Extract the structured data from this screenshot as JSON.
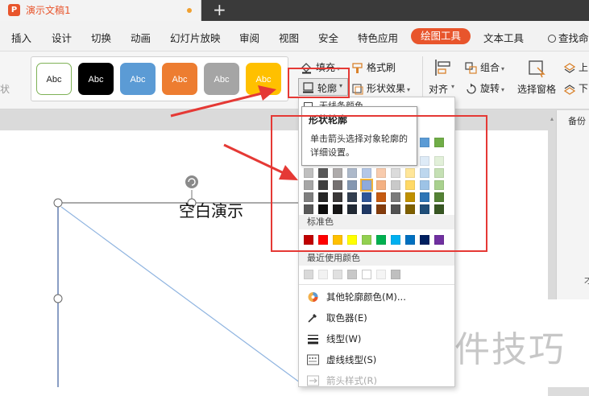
{
  "title_bar": {
    "doc_name": "演示文稿1",
    "new_tab": "+",
    "logo_glyph": "P"
  },
  "menu": {
    "items": [
      "插入",
      "设计",
      "切换",
      "动画",
      "幻灯片放映",
      "审阅",
      "视图",
      "安全",
      "特色应用"
    ],
    "active": "绘图工具",
    "after_active": "文本工具",
    "search": "查找命"
  },
  "ribbon": {
    "left_partial": "状",
    "styles": [
      {
        "label": "Abc",
        "fill": "#ffffff",
        "border": "#7fb257",
        "text": "#222222"
      },
      {
        "label": "Abc",
        "fill": "#000000",
        "border": "#000000",
        "text": "#ffffff"
      },
      {
        "label": "Abc",
        "fill": "#5b9bd5",
        "border": "#5b9bd5",
        "text": "#ffffff"
      },
      {
        "label": "Abc",
        "fill": "#ed7d31",
        "border": "#ed7d31",
        "text": "#ffffff"
      },
      {
        "label": "Abc",
        "fill": "#a5a5a5",
        "border": "#a5a5a5",
        "text": "#ffffff"
      },
      {
        "label": "Abc",
        "fill": "#ffc000",
        "border": "#ffc000",
        "text": "#ffffff"
      }
    ],
    "fill": "填充",
    "format_painter": "格式刷",
    "outline": "轮廓",
    "shape_effects": "形状效果",
    "align": "对齐",
    "group": "组合",
    "rotate": "旋转",
    "selection_pane": "选择窗格",
    "up": "上",
    "down": "下"
  },
  "dropdown": {
    "partial_top": "无线条颜色",
    "tooltip_title": "形状轮廓",
    "tooltip_desc": "单击箭头选择对象轮廓的详细设置。",
    "standard_label": "标准色",
    "recent_label": "最近使用颜色",
    "theme_colors": [
      [
        "#ffffff",
        "#000000",
        "#e7e6e6",
        "#44546a",
        "#4472c4",
        "#ed7d31",
        "#a5a5a5",
        "#ffc000",
        "#5b9bd5",
        "#70ad47"
      ],
      [
        "#d9d9d9",
        "#7f7f7f",
        "#d0cece",
        "#d6dce4",
        "#d9e2f3",
        "#fbe5d6",
        "#ededed",
        "#fff2cc",
        "#deebf7",
        "#e2f0d9"
      ],
      [
        "#bfbfbf",
        "#595959",
        "#aeabab",
        "#adb9ca",
        "#b4c7e7",
        "#f8cbad",
        "#dbdbdb",
        "#ffe699",
        "#bdd7ee",
        "#c5e0b4"
      ],
      [
        "#a6a6a6",
        "#404040",
        "#757171",
        "#8497b0",
        "#8faadc",
        "#f4b183",
        "#c9c9c9",
        "#ffd966",
        "#9dc3e6",
        "#a9d18e"
      ],
      [
        "#7f7f7f",
        "#262626",
        "#3a3838",
        "#333f50",
        "#2f5597",
        "#c55a11",
        "#7b7b7b",
        "#bf9000",
        "#2e75b6",
        "#548235"
      ],
      [
        "#595959",
        "#0d0d0d",
        "#171616",
        "#222a35",
        "#1f3864",
        "#843c0c",
        "#525252",
        "#7f6000",
        "#1f4e79",
        "#385723"
      ]
    ],
    "standard_colors": [
      "#c00000",
      "#ff0000",
      "#ffc000",
      "#ffff00",
      "#92d050",
      "#00b050",
      "#00b0f0",
      "#0070c0",
      "#002060",
      "#7030a0"
    ],
    "recent_colors": [
      "#d9d9d9",
      "#f2f2f2",
      "#e0e0e0",
      "#c8c8c8",
      "#ffffff",
      "#f5f5f5",
      "#bfbfbf"
    ],
    "items": {
      "more_colors": "其他轮廓颜色(M)...",
      "eyedropper": "取色器(E)",
      "line_type": "线型(W)",
      "dash_type": "虚线线型(S)",
      "arrow_style": "箭头样式(R)"
    }
  },
  "slide": {
    "text": "空白演示"
  },
  "right_panel": {
    "label": "备份",
    "partial": "才"
  },
  "watermark": "软件技巧",
  "colors": {
    "accent": "#e8552c",
    "annotation": "#e53935"
  }
}
